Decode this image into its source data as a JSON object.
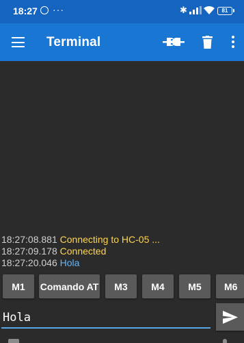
{
  "status_bar": {
    "time": "18:27",
    "more_indicator": "···",
    "bluetooth_glyph": "✱",
    "battery": "81"
  },
  "app_bar": {
    "title": "Terminal",
    "menu_icon": "hamburger-menu-icon",
    "connect_icon": "plug-connect-icon",
    "delete_icon": "trash-icon",
    "overflow_icon": "more-vert-icon"
  },
  "terminal": {
    "lines": [
      {
        "timestamp": "18:27:08.881",
        "text": "Connecting to HC-05 ...",
        "kind": "status"
      },
      {
        "timestamp": "18:27:09.178",
        "text": "Connected",
        "kind": "status"
      },
      {
        "timestamp": "18:27:20.046",
        "text": "Hola",
        "kind": "data"
      }
    ]
  },
  "macros": [
    "M1",
    "Comando AT",
    "M3",
    "M4",
    "M5",
    "M6"
  ],
  "input": {
    "value": "Hola",
    "send_icon": "send-icon"
  },
  "colors": {
    "status_bar": "#1565c0",
    "app_bar": "#1976d2",
    "background": "#2b2b2b",
    "status_text": "#ffd54f",
    "data_text": "#64b5f6",
    "input_underline": "#5aa7e6"
  }
}
